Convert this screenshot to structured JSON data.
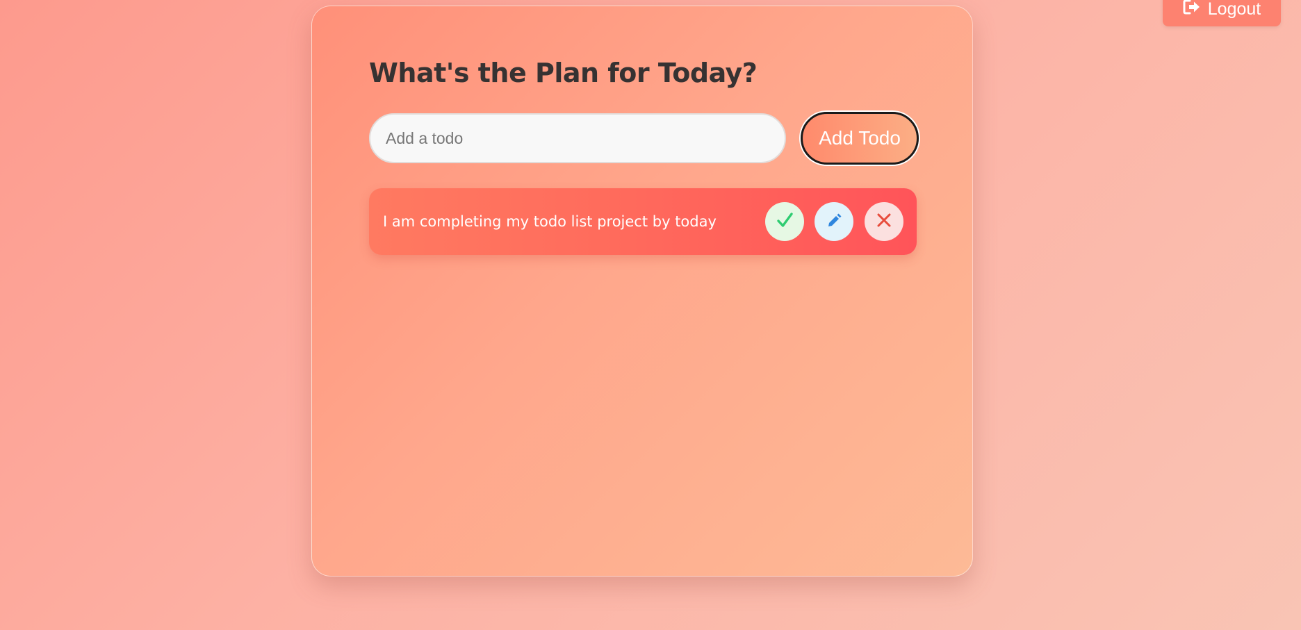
{
  "header": {
    "logout_label": "Logout",
    "logout_icon": "sign-out-icon"
  },
  "main": {
    "title": "What's the Plan for Today?",
    "todo_input": {
      "placeholder": "Add a todo",
      "value": ""
    },
    "add_button_label": "Add Todo"
  },
  "todos": [
    {
      "text": "I am completing my todo list project by today",
      "actions": {
        "complete_icon": "check-icon",
        "edit_icon": "pencil-icon",
        "delete_icon": "close-icon"
      }
    }
  ],
  "colors": {
    "accent": "#ff7a61",
    "complete": "#2ecc71",
    "edit": "#3498db",
    "delete": "#e74c3c",
    "title_text": "#363232"
  }
}
